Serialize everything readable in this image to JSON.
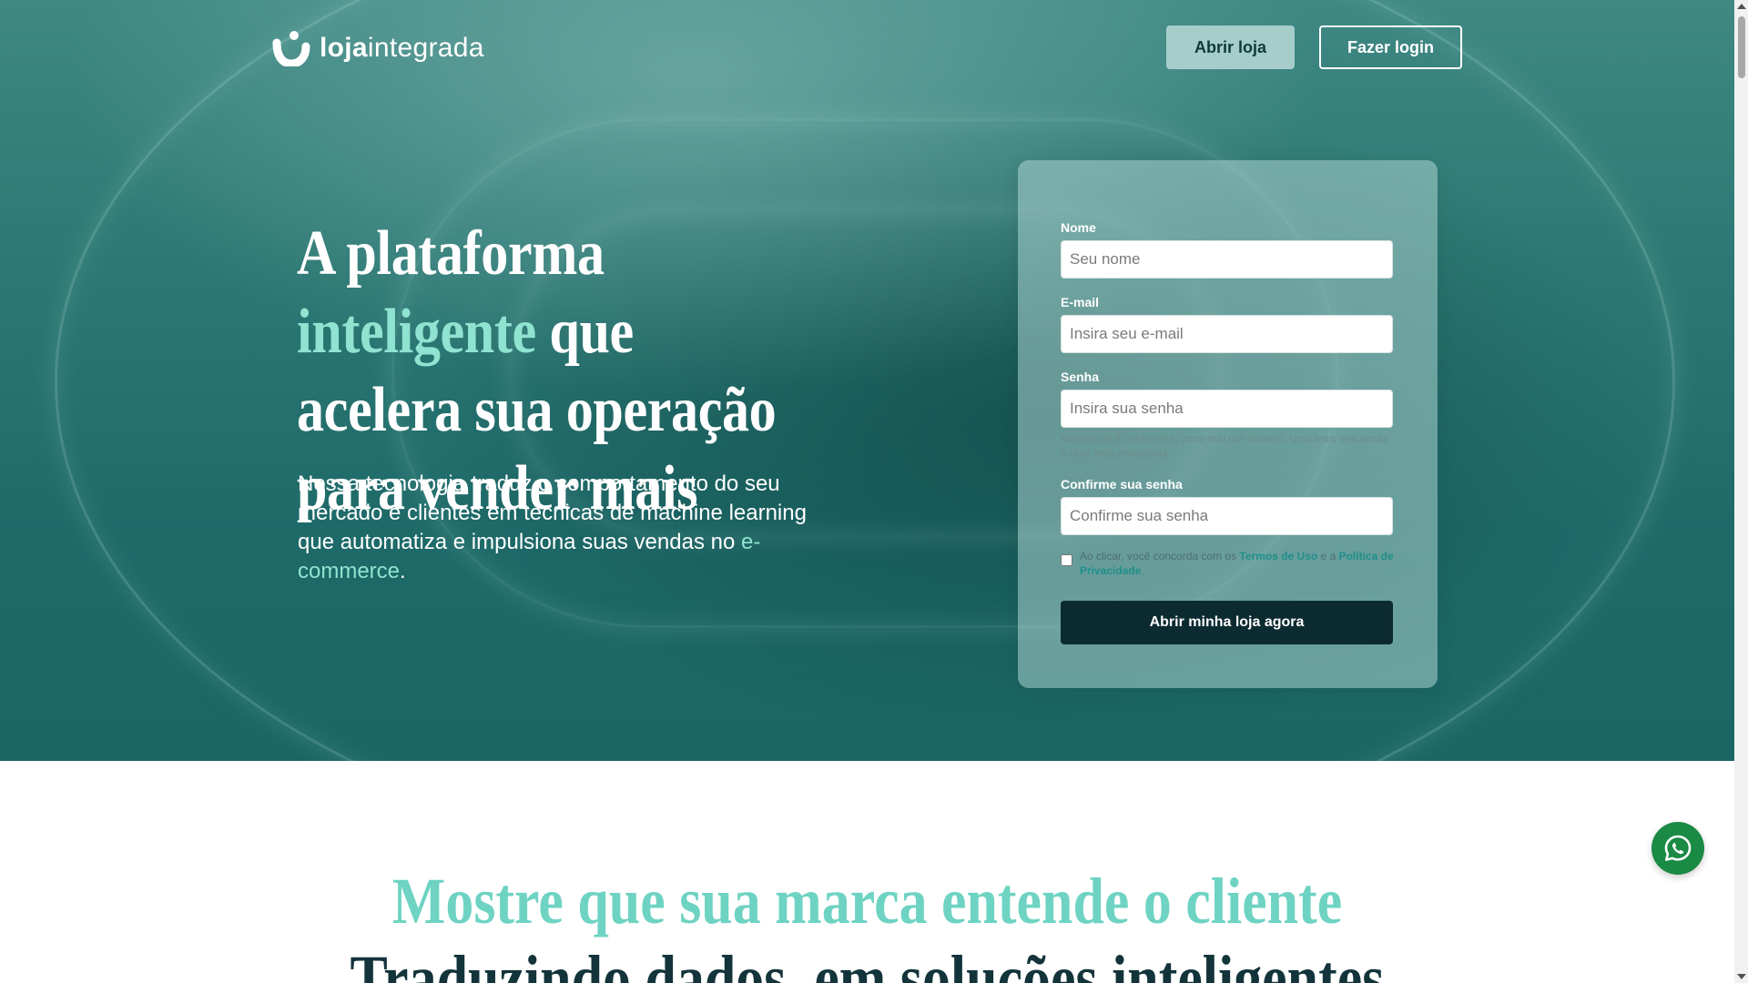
{
  "header": {
    "logo_bold": "loja",
    "logo_light": "integrada",
    "open_store_label": "Abrir loja",
    "login_label": "Fazer login"
  },
  "hero": {
    "headline_part1": "A plataforma ",
    "headline_accent": "inteligente",
    "headline_part2": " que acelera sua operação para vender mais",
    "sub_part1": "Nossa tecnologia traduz o comportamento do seu mercado e clientes em técnicas de machine learning que automatiza e impulsiona suas vendas no ",
    "sub_accent": "e-commerce",
    "sub_end": "."
  },
  "form": {
    "name_label": "Nome",
    "name_placeholder": "Seu nome",
    "email_label": "E-mail",
    "email_placeholder": "Insira seu e-mail",
    "password_label": "Senha",
    "password_placeholder": "Insira sua senha",
    "password_hint": "Mínimo de 8 caracteres, contendo um número, uma letra maiúscula e uma letra minúscula",
    "confirm_label": "Confirme sua senha",
    "confirm_placeholder": "Confirme sua senha",
    "terms_prefix": "Ao clicar, você concorda com os ",
    "terms_link": "Termos de Uso",
    "terms_mid": " e a ",
    "privacy_link": "Política de Privacidade",
    "terms_end": ".",
    "submit_label": "Abrir minha loja agora"
  },
  "section": {
    "title": "Mostre que sua marca entende o cliente",
    "subtitle": "Traduzindo dados, em soluções inteligentes"
  },
  "icons": {
    "logo": "loja-integrada-logo-icon",
    "whatsapp": "whatsapp-icon"
  },
  "colors": {
    "accent": "#8fe3d0",
    "section_title": "#6ed3c2",
    "submit_bg": "#0c2b31",
    "whatsapp": "#1a8a45"
  }
}
